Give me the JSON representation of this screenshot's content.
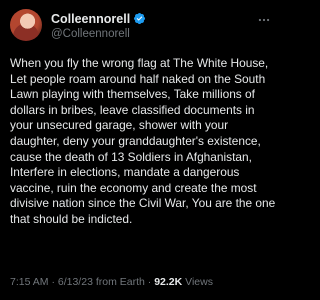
{
  "tweet": {
    "display_name": "Colleennorell",
    "handle": "@Colleennorell",
    "text": "When you fly the wrong flag at The White House, Let people roam around half naked on the South Lawn playing with themselves, Take millions of dollars in bribes, leave classified documents in your unsecured garage, shower with your daughter, deny your granddaughter's existence, cause the death of 13 Soldiers in Afghanistan, Interfere in elections, mandate a dangerous vaccine, ruin the economy and create the most divisive nation since the Civil War, You are the one that should be indicted.",
    "meta": {
      "time": "7:15 AM",
      "date": "6/13/23",
      "source": "from Earth",
      "separator": "·",
      "views_count": "92.2K",
      "views_label": "Views"
    },
    "icons": {
      "verified": "verified-badge-icon",
      "more": "more-options-icon"
    }
  },
  "colors": {
    "background": "#000000",
    "text": "#e7e9ea",
    "secondary": "#71767b",
    "verified": "#1d9bf0"
  }
}
